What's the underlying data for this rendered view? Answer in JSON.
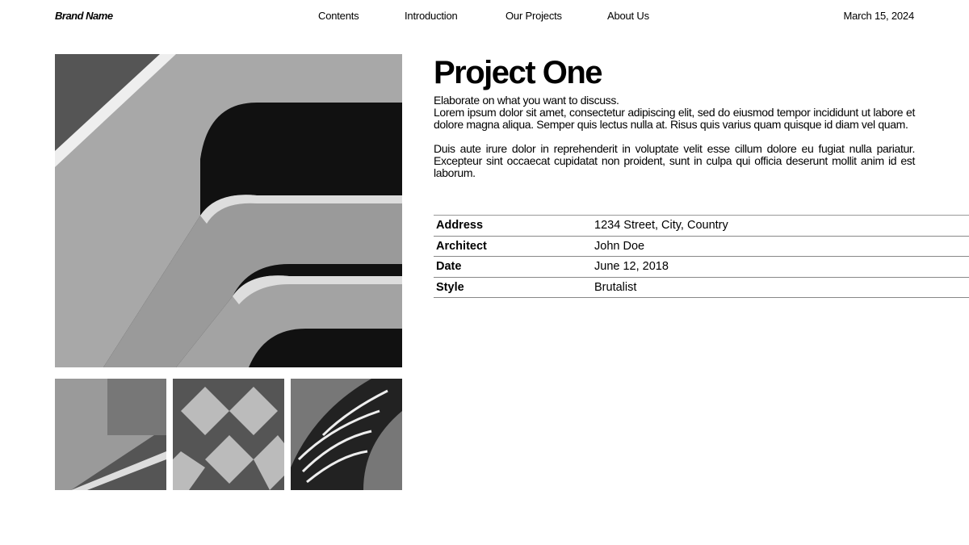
{
  "header": {
    "brand": "Brand Name",
    "nav": [
      "Contents",
      "Introduction",
      "Our Projects",
      "About Us"
    ],
    "date": "March 15, 2024"
  },
  "main": {
    "title": "Project One",
    "subtitle": "Elaborate on what you want to discuss.",
    "paragraphs": [
      "Lorem ipsum dolor sit amet, consectetur adipiscing elit, sed do eiusmod tempor incididunt ut labore et dolore magna aliqua. Semper quis lectus nulla at. Risus quis varius quam quisque id diam vel quam.",
      "Duis aute irure dolor in reprehenderit in voluptate velit esse cillum dolore eu fugiat nulla pariatur. Excepteur sint occaecat cupidatat non proident, sunt in culpa qui officia deserunt mollit anim id est laborum."
    ],
    "details": [
      {
        "label": "Address",
        "value": "1234 Street, City, Country"
      },
      {
        "label": "Architect",
        "value": "John Doe"
      },
      {
        "label": "Date",
        "value": "June 12, 2018"
      },
      {
        "label": "Style",
        "value": "Brutalist"
      }
    ]
  },
  "images": [
    "main-building-photo",
    "building-thumbnail-1",
    "building-thumbnail-2",
    "building-thumbnail-3"
  ]
}
